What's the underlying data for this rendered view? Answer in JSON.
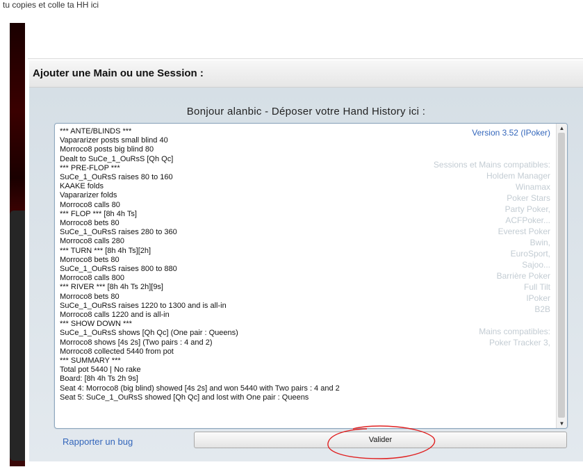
{
  "top_caption": "tu copies et colle ta HH ici",
  "panel": {
    "title": "Ajouter une Main ou une Session :",
    "greeting": "Bonjour alanbic - Déposer votre Hand History ici :"
  },
  "hand_history_lines": [
    "*** ANTE/BLINDS ***",
    "Vapararizer posts small blind 40",
    "Morroco8 posts big blind 80",
    "Dealt to SuCe_1_OuRsS [Qh Qc]",
    "*** PRE-FLOP ***",
    "SuCe_1_OuRsS raises 80 to 160",
    "KAAKE folds",
    "Vapararizer folds",
    "Morroco8 calls 80",
    "*** FLOP *** [8h 4h Ts]",
    "Morroco8 bets 80",
    "SuCe_1_OuRsS raises 280 to 360",
    "Morroco8 calls 280",
    "*** TURN *** [8h 4h Ts][2h]",
    "Morroco8 bets 80",
    "SuCe_1_OuRsS raises 800 to 880",
    "Morroco8 calls 800",
    "*** RIVER *** [8h 4h Ts 2h][9s]",
    "Morroco8 bets 80",
    "SuCe_1_OuRsS raises 1220 to 1300 and is all-in",
    "Morroco8 calls 1220 and is all-in",
    "*** SHOW DOWN ***",
    "SuCe_1_OuRsS shows [Qh Qc] (One pair : Queens)",
    "Morroco8 shows [4s 2s] (Two pairs : 4 and 2)",
    "Morroco8 collected 5440 from pot",
    "*** SUMMARY ***",
    "Total pot 5440 | No rake",
    "Board: [8h 4h Ts 2h 9s]",
    "Seat 4: Morroco8 (big blind) showed [4s 2s] and won 5440 with Two pairs : 4 and 2",
    "Seat 5: SuCe_1_OuRsS showed [Qh Qc] and lost with One pair : Queens"
  ],
  "version_label": "Version 3.52 (IPoker)",
  "compat_sessions": {
    "heading": "Sessions et Mains compatibles:",
    "items": [
      "Holdem Manager",
      "Winamax",
      "Poker Stars",
      "Party Poker,",
      "ACFPoker...",
      "Everest Poker",
      "Bwin,",
      "EuroSport,",
      "Sajoo...",
      "Barrière Poker",
      "Full Tilt",
      "IPoker",
      "B2B"
    ]
  },
  "compat_hands": {
    "heading": "Mains compatibles:",
    "items": [
      "Poker Tracker 3,"
    ]
  },
  "bug_link": "Rapporter un bug",
  "submit_label": "Valider",
  "colors": {
    "link": "#3366bb",
    "annotation": "#e02020",
    "muted": "#c3ccd3"
  },
  "icons": {
    "scroll_up": "▲",
    "scroll_down": "▼"
  }
}
